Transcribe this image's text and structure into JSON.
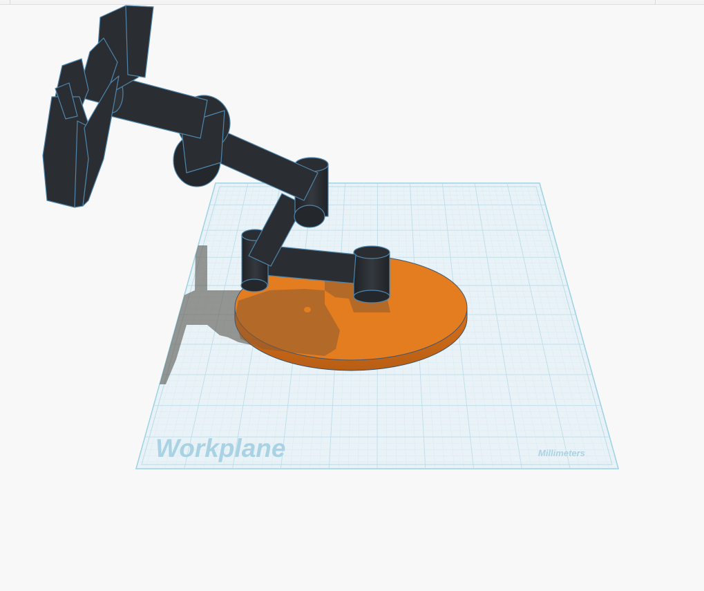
{
  "scene": {
    "workplane_label": "Workplane",
    "units_label": "Millimeters",
    "colors": {
      "workplane_fill": "#e9f3f7",
      "workplane_edge": "#8ccbe0",
      "grid_major": "#bcdde9",
      "grid_minor": "#d7eaf1",
      "label_color": "#a9d3e4",
      "base_disc": "#e37d20",
      "base_disc_side": "#c7681a",
      "arm_body": "#2a2e33",
      "arm_edge": "#4f86ad",
      "shadow": "#5d5b58"
    },
    "objects": [
      "base-disc",
      "robot-arm",
      "gripper"
    ]
  }
}
